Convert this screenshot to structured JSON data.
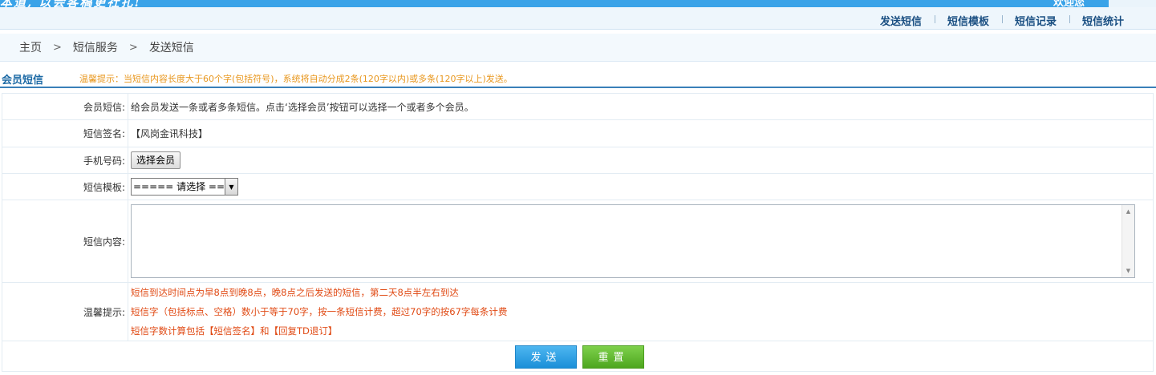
{
  "banner": {
    "text": "本道, 以会客稿更社扎!",
    "right_text": "欢迎您"
  },
  "topnav": {
    "items": [
      {
        "label": "发送短信"
      },
      {
        "label": "短信模板"
      },
      {
        "label": "短信记录"
      },
      {
        "label": "短信统计"
      }
    ]
  },
  "breadcrumb": {
    "home": "主页",
    "level1": "短信服务",
    "level2": "发送短信",
    "separator": ">"
  },
  "section": {
    "title": "会员短信",
    "tip": "温馨提示：当短信内容长度大于60个字(包括符号)，系统将自动分成2条(120字以内)或多条(120字以上)发送。"
  },
  "form": {
    "member_label": "会员短信:",
    "member_desc": "给会员发送一条或者多条短信。点击‘选择会员’按钮可以选择一个或者多个会员。",
    "signature_label": "短信签名:",
    "signature_value": "【风岗金讯科技】",
    "phone_label": "手机号码:",
    "select_member_button": "选择会员",
    "template_label": "短信模板:",
    "template_selected": "===== 请选择 =====",
    "content_label": "短信内容:",
    "content_value": "",
    "tips_label": "温馨提示:",
    "tips": [
      "短信到达时间点为早8点到晚8点，晚8点之后发送的短信，第二天8点半左右到达",
      "短信字（包括标点、空格）数小于等于70字，按一条短信计费，超过70字的按67字每条计费",
      "短信字数计算包括【短信签名】和【回复TD退订】"
    ]
  },
  "buttons": {
    "send": "发送",
    "reset": "重置"
  },
  "colors": {
    "banner": "#3aa3e8",
    "nav_text": "#1a4f82",
    "section_title": "#1d6aa5",
    "section_tip": "#e8971e",
    "tip_text": "#e04a14",
    "send_button": "#1b8fd8",
    "reset_button": "#4da61e"
  }
}
